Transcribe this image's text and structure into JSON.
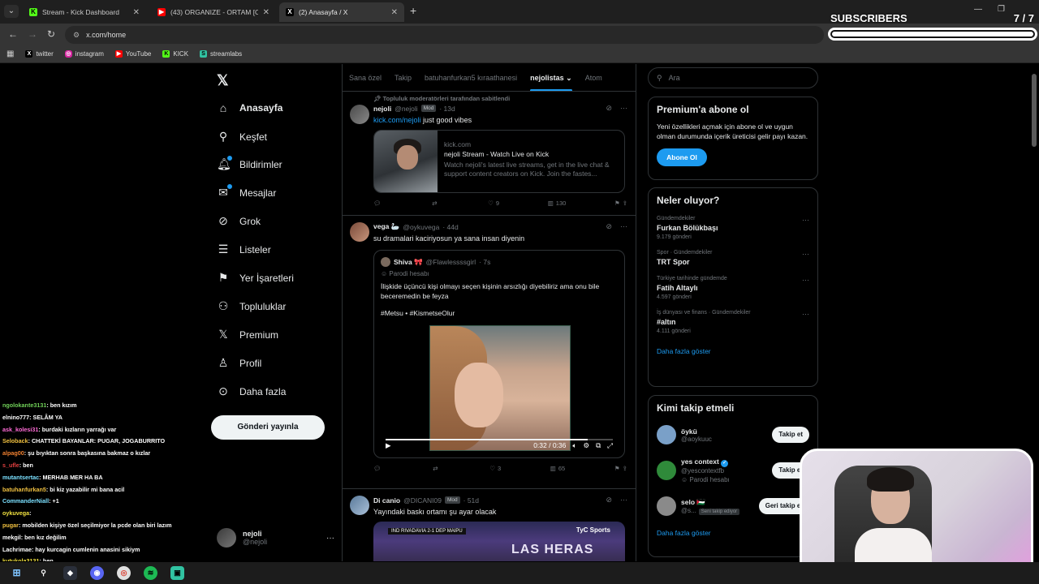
{
  "browser": {
    "tabs": [
      {
        "title": "Stream - Kick Dashboard",
        "favicon": "kick-icon"
      },
      {
        "title": "(43) ORGANIZE - ORTAM [OFFI",
        "favicon": "youtube-icon"
      },
      {
        "title": "(2) Anasayfa / X",
        "favicon": "x-icon"
      }
    ],
    "url": "x.com/home",
    "bookmarks": [
      {
        "label": "twitter",
        "icon": "x-icon"
      },
      {
        "label": "instagram",
        "icon": "instagram-icon"
      },
      {
        "label": "YouTube",
        "icon": "youtube-icon"
      },
      {
        "label": "KICK",
        "icon": "kick-icon"
      },
      {
        "label": "streamlabs",
        "icon": "streamlabs-icon"
      }
    ]
  },
  "nav": {
    "items": [
      {
        "label": "Anasayfa",
        "icon": "home-icon"
      },
      {
        "label": "Keşfet",
        "icon": "search-icon"
      },
      {
        "label": "Bildirimler",
        "icon": "bell-icon"
      },
      {
        "label": "Mesajlar",
        "icon": "mail-icon"
      },
      {
        "label": "Grok",
        "icon": "grok-icon"
      },
      {
        "label": "Listeler",
        "icon": "list-icon"
      },
      {
        "label": "Yer İşaretleri",
        "icon": "bookmark-icon"
      },
      {
        "label": "Topluluklar",
        "icon": "communities-icon"
      },
      {
        "label": "Premium",
        "icon": "x-icon"
      },
      {
        "label": "Profil",
        "icon": "profile-icon"
      },
      {
        "label": "Daha fazla",
        "icon": "more-icon"
      }
    ],
    "post_button": "Gönderi yayınla",
    "account": {
      "name": "nejoli",
      "handle": "@nejoli",
      "more": "···"
    }
  },
  "chat": [
    {
      "user": "ngolokante3131",
      "msg": ": ben kızım",
      "color": "#6fcf57"
    },
    {
      "user": "elnino777",
      "msg": ": SELÂM YA",
      "color": "#ffffff"
    },
    {
      "user": "ask_kolesi31",
      "msg": ": burdaki kızların yarrağı var",
      "color": "#ff6bd6"
    },
    {
      "user": "Seloback",
      "msg": ": CHATTEKİ BAYANLAR: PUGAR, JOGABURRITO",
      "color": "#f0c040"
    },
    {
      "user": "alpag00",
      "msg": ": şu bıyıktan sonra başkasına bakmaz o kızlar",
      "color": "#f08030"
    },
    {
      "user": "s_ufle",
      "msg": ": ben",
      "color": "#e04040"
    },
    {
      "user": "mutantsertac",
      "msg": ": MERHAB MER HA BA",
      "color": "#7be0ff"
    },
    {
      "user": "batuhanfurkan5",
      "msg": ": bi kiz yazabilir mi bana acil",
      "color": "#f0c040"
    },
    {
      "user": "CommanderNiall",
      "msg": ": +1",
      "color": "#7be0ff"
    },
    {
      "user": "oykuvega",
      "msg": ": ",
      "color": "#f0e040"
    },
    {
      "user": "pugar",
      "msg": ": mobilden kişiye özel seçilmiyor la pcde olan biri lazım",
      "color": "#f0c040"
    },
    {
      "user": "mekgil",
      "msg": ": ben kız değilim",
      "color": "#ffffff"
    },
    {
      "user": "Lachrimae",
      "msg": ": hay kurcagin cumlenin anasini sikiym",
      "color": "#ffffff"
    },
    {
      "user": "kutukola3131",
      "msg": ": ben",
      "color": "#f0e040"
    }
  ],
  "timeline": {
    "tabs": [
      "Sana özel",
      "Takip",
      "batuhanfurkan5 kıraathanesi",
      "nejolistas",
      "Atom"
    ],
    "active_tab": "nejolistas",
    "posts": [
      {
        "pinned": "Topluluk moderatörleri tarafından sabitlendi",
        "name": "nejoli",
        "handle": "@nejoli",
        "badge": "Mod",
        "time": "· 13d",
        "link_text": "kick.com/nejoli",
        "text": " just good vibes",
        "card": {
          "domain": "kick.com",
          "title": "nejoli Stream - Watch Live on Kick",
          "desc": "Watch nejoli's latest live streams, get in the live chat & support content creators on Kick. Join the fastes..."
        },
        "actions": {
          "replies": "",
          "reposts": "",
          "likes": "9",
          "views": "130"
        }
      },
      {
        "name": "vega 🦢",
        "handle": "@oykuvega",
        "time": "· 44d",
        "text": "su dramalari kaciriyosun ya sana insan diyenin",
        "quote": {
          "name": "Shiva 🎀",
          "handle": "@Flawlessssgirl",
          "time": "· 7s",
          "sub": "Parodi hesabı",
          "text": "İlişkide üçüncü kişi olmayı seçen kişinin arsızlığı diyebiliriz ama onu bile beceremedin be feyza",
          "tags": "#Metsu • #KismetseOlur",
          "video_time": "0:32 / 0:36",
          "progress": 0.89
        },
        "actions": {
          "replies": "",
          "reposts": "",
          "likes": "3",
          "views": "65"
        }
      },
      {
        "name": "Di canio",
        "handle": "@DICANI09",
        "badge": "Mod",
        "time": "· 51d",
        "text": "Yayındaki baskı ortamı şu ayar olacak",
        "image": {
          "score": "IND RIVADAVIA 2-1 DEP MAIPU",
          "brand": "TyC Sports",
          "banner": "LAS HERAS"
        }
      }
    ]
  },
  "right": {
    "search_placeholder": "Ara",
    "premium": {
      "title": "Premium'a abone ol",
      "text": "Yeni özellikleri açmak için abone ol ve uygun olman durumunda içerik üreticisi gelir payı kazan.",
      "button": "Abone Ol"
    },
    "trends_title": "Neler oluyor?",
    "trends": [
      {
        "context": "Gündemdekiler",
        "name": "Furkan Bölükbaşı",
        "count": "9.179 gönderi"
      },
      {
        "context": "Spor · Gündemdekiler",
        "name": "TRT Spor",
        "count": ""
      },
      {
        "context": "Türkiye tarihinde gündemde",
        "name": "Fatih Altaylı",
        "count": "4.597 gönderi"
      },
      {
        "context": "İş dünyası ve finans · Gündemdekiler",
        "name": "#altın",
        "count": "4.111 gönderi"
      }
    ],
    "show_more": "Daha fazla göster",
    "who_title": "Kimi takip etmeli",
    "who": [
      {
        "name": "öykü",
        "handle": "@aoykuuc",
        "extra": "",
        "button": "Takip et",
        "color": "#7aa0c8"
      },
      {
        "name": "yes context",
        "handle": "@yescontextfb",
        "extra": "Parodi hesabı",
        "button": "Takip et",
        "color": "#2f8a3a"
      },
      {
        "name": "selo 🇵🇸",
        "handle": "@s...",
        "extra": "Seni takip ediyor",
        "button": "Geri takip et",
        "color": "#8a8a8a"
      }
    ],
    "who_show_more": "Daha fazla göster"
  },
  "overlay": {
    "subs_label": "SUBSCRIBERS",
    "subs_count": "7 / 7",
    "subs_progress": 1.0
  },
  "colors": {
    "accent": "#1d9bf0",
    "background": "#000000",
    "border": "#2f3336"
  }
}
